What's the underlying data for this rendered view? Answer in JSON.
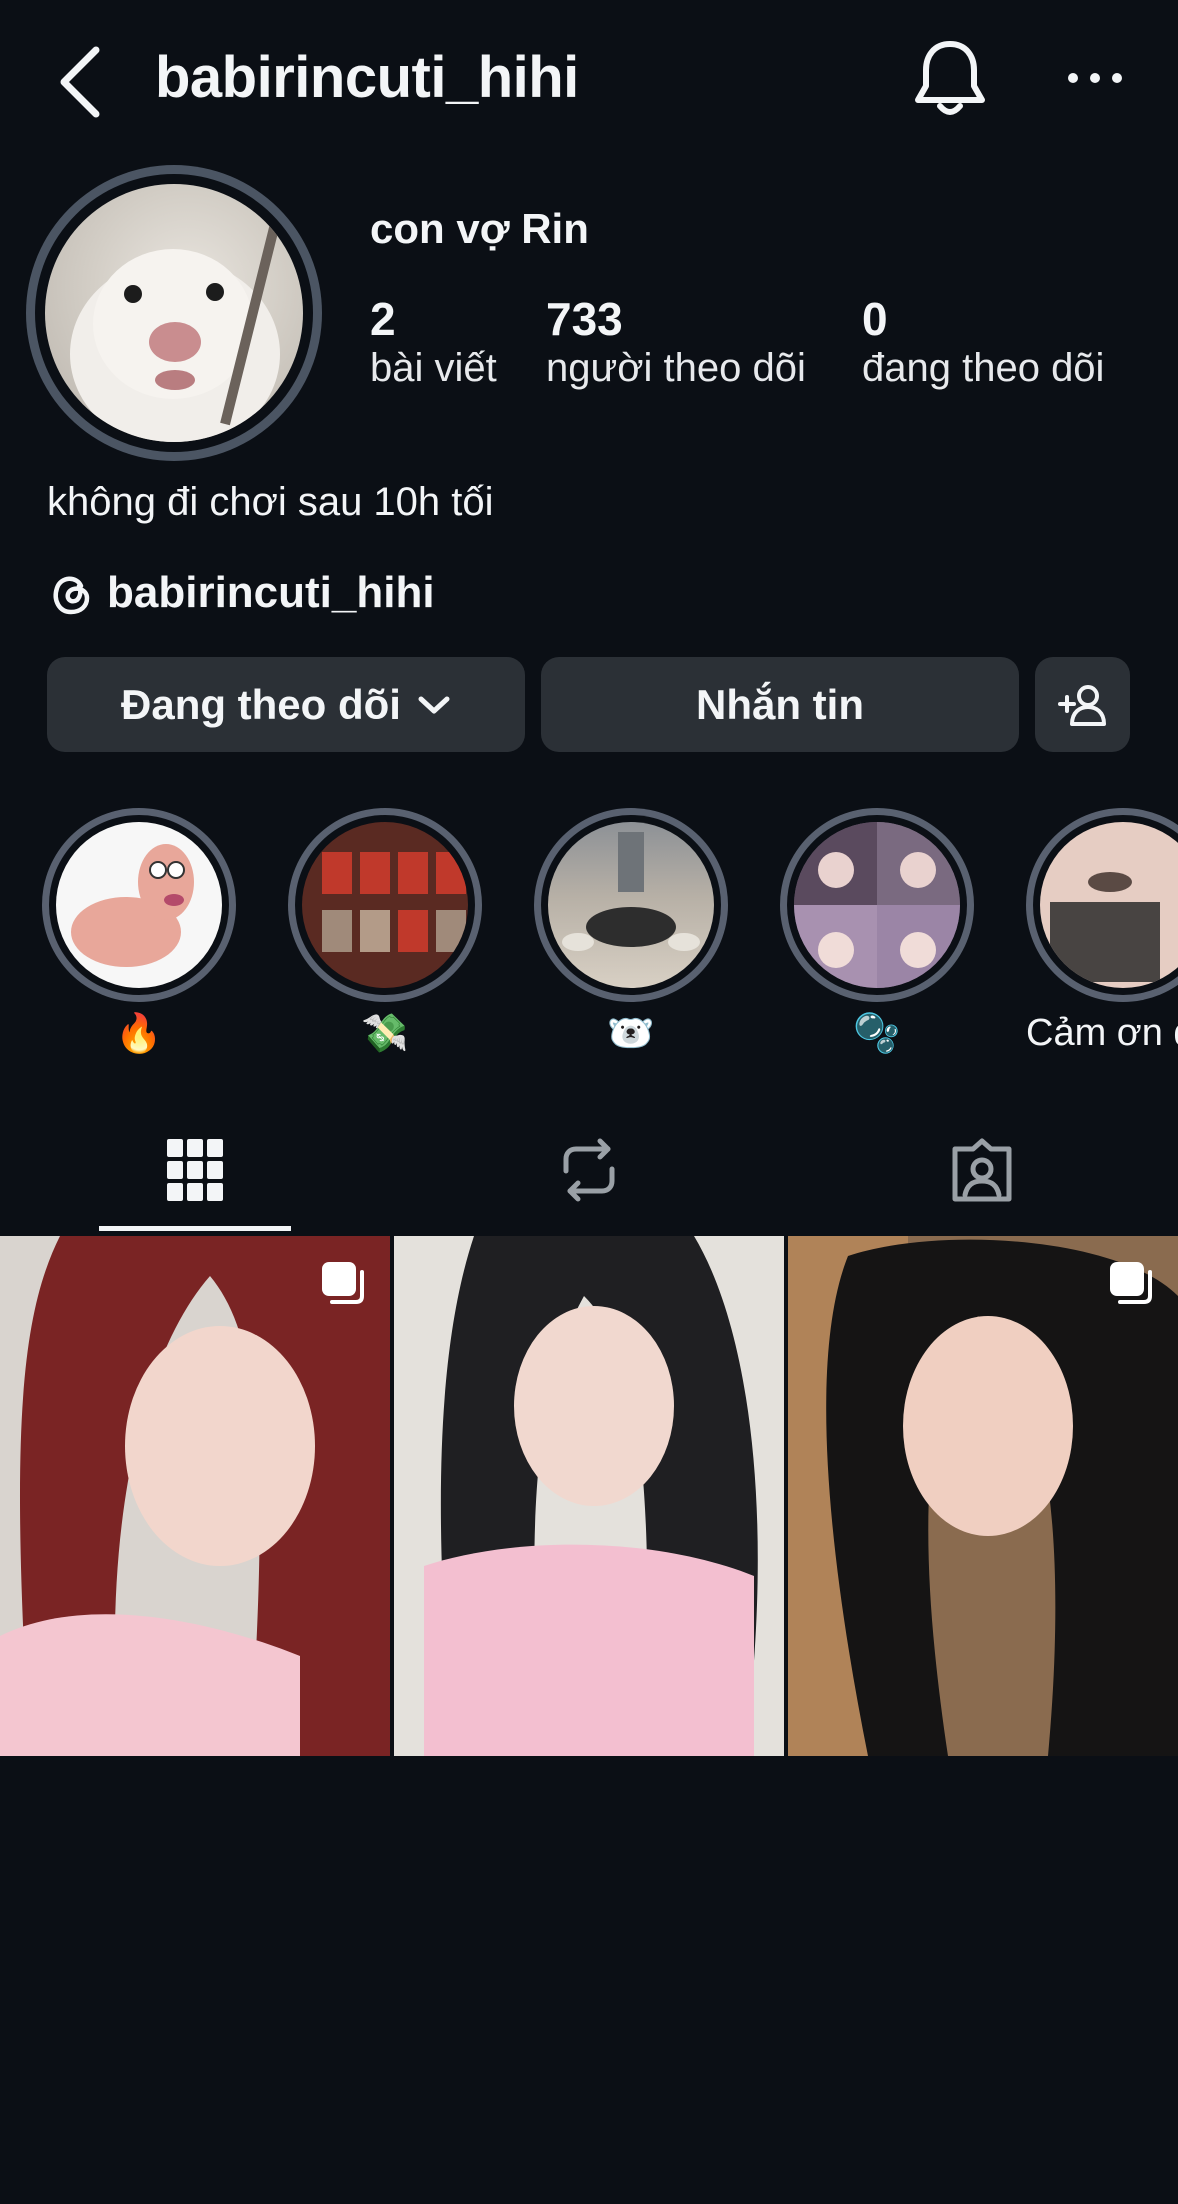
{
  "header": {
    "title": "babirincuti_hihi",
    "icons": [
      "back-icon",
      "bell-icon",
      "more-icon"
    ]
  },
  "profile": {
    "display_name": "con vợ Rin",
    "stats": [
      {
        "count": "2",
        "label": "bài viết"
      },
      {
        "count": "733",
        "label": "người theo dõi"
      },
      {
        "count": "0",
        "label": "đang theo dõi"
      }
    ],
    "bio": "không đi chơi sau 10h tối",
    "threads_handle": "babirincuti_hihi"
  },
  "actions": {
    "following_label": "Đang theo dõi",
    "message_label": "Nhắn tin"
  },
  "highlights": [
    {
      "label": "🔥"
    },
    {
      "label": "💸"
    },
    {
      "label": "🐻‍❄️"
    },
    {
      "label": "🫧"
    },
    {
      "label": "Cảm ơn đ"
    }
  ],
  "tabs": [
    "grid-icon",
    "reposts-icon",
    "tagged-icon"
  ],
  "colors": {
    "background": "#0b0f15",
    "button": "#2b3036",
    "text": "#f3f5f7",
    "ring": "#596170"
  }
}
